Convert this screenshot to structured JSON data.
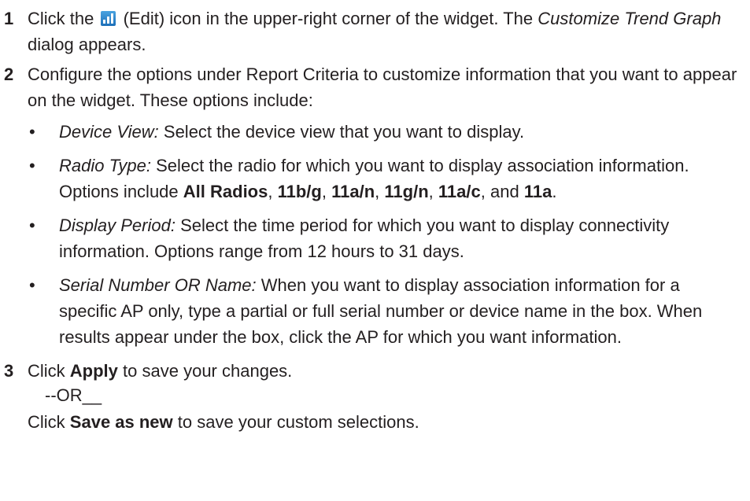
{
  "steps": [
    {
      "num": "1",
      "a": "Click the",
      "icon": "edit-bar-chart-icon",
      "b": "(Edit) icon in the upper-right corner of the widget. The",
      "dialog": "Customize Trend Graph",
      "c": "dialog appears."
    },
    {
      "num": "2",
      "text": "Configure the options under Report Criteria to customize information that you want to appear on the widget. These options include:",
      "options": [
        {
          "bullet": "•",
          "label": "Device View:",
          "text": "Select the device view that you want to display."
        },
        {
          "bullet": "•",
          "label": "Radio Type:",
          "text": "Select the radio for which you want to display association information. Options include",
          "values": [
            "All Radios",
            "11b/g",
            "11a/n",
            "11g/n",
            "11a/c",
            "11a"
          ],
          "sep": ",",
          "and": "and",
          "end": "."
        },
        {
          "bullet": "•",
          "label": "Display Period:",
          "text": "Select the time period for which you want to display connectivity information. Options range from 12 hours to 31 days."
        },
        {
          "bullet": "•",
          "label": "Serial Number OR Name:",
          "text": "When you want to display association information for a specific AP only, type a partial or full serial number or device name in the box. When results appear under the box, click the AP for which you want information."
        }
      ]
    },
    {
      "num": "3",
      "a": "Click",
      "btn": "Apply",
      "b": "to save your changes.",
      "or": "--OR__",
      "c": "Click",
      "btn2": "Save as new",
      "d": "to save your custom selections."
    }
  ]
}
